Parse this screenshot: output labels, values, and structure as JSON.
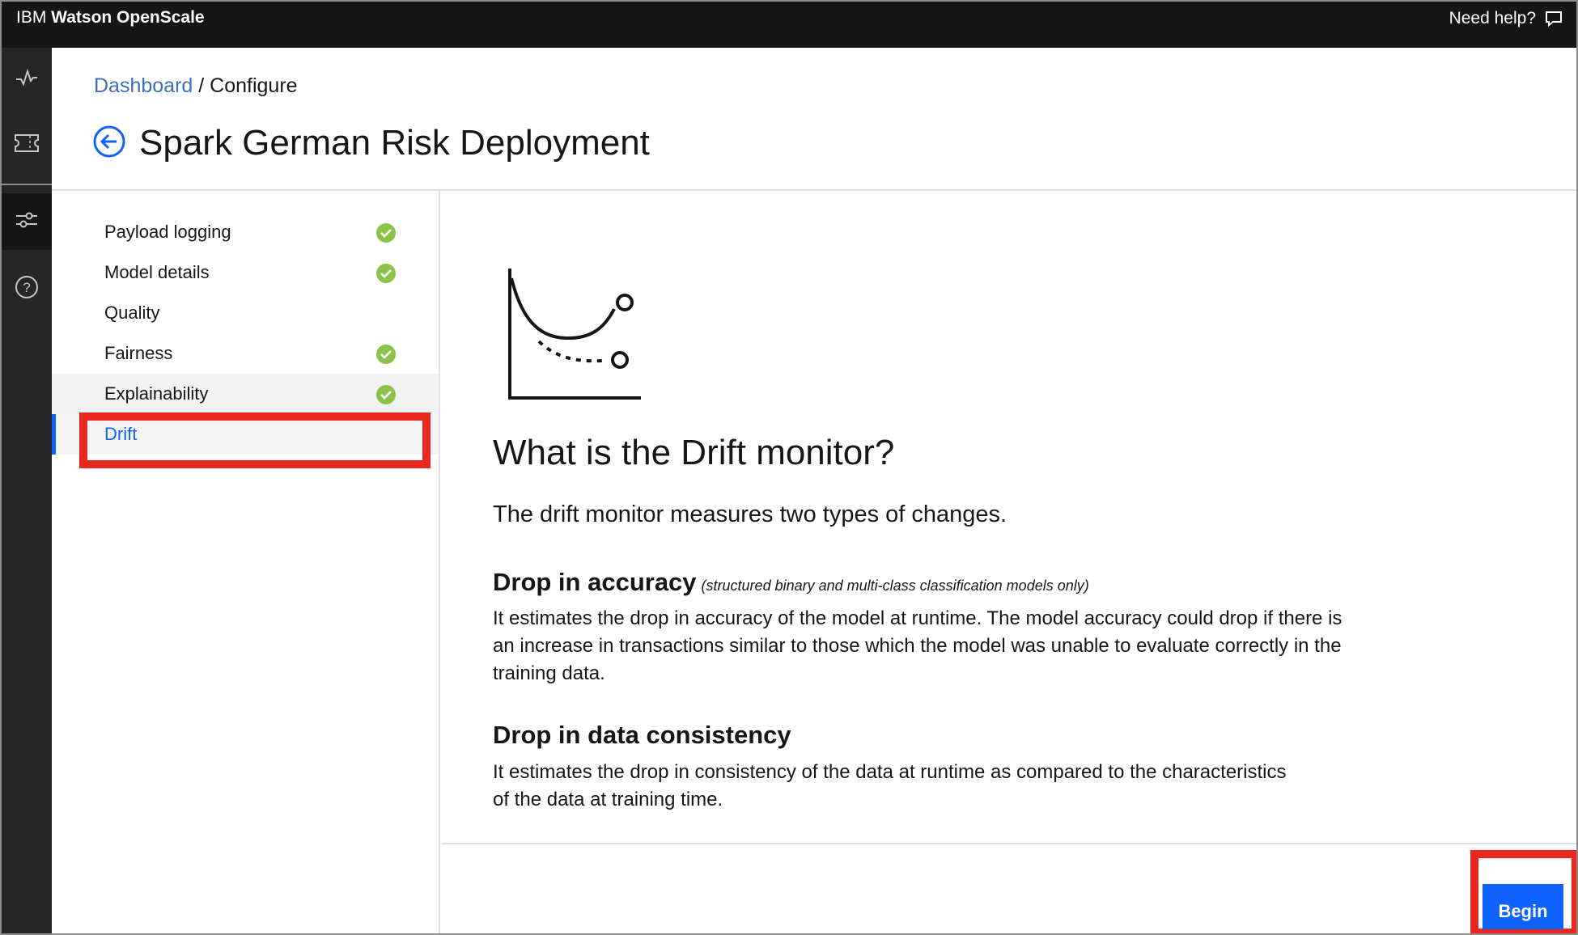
{
  "app": {
    "brand_prefix": "IBM ",
    "brand_name": "Watson OpenScale",
    "help_label": "Need help?"
  },
  "rail": {
    "icons": [
      "activity-icon",
      "ticket-icon",
      "sliders-icon",
      "help-circle-icon"
    ]
  },
  "breadcrumb": {
    "link": "Dashboard",
    "separator": " / ",
    "current": "Configure"
  },
  "page": {
    "title": "Spark German Risk Deployment"
  },
  "nav": {
    "items": [
      {
        "label": "Payload logging",
        "complete": true
      },
      {
        "label": "Model details",
        "complete": true
      },
      {
        "label": "Quality",
        "complete": false
      },
      {
        "label": "Fairness",
        "complete": true
      },
      {
        "label": "Explainability",
        "complete": true
      },
      {
        "label": "Drift",
        "complete": false,
        "selected": true
      }
    ]
  },
  "main": {
    "heading": "What is the Drift monitor?",
    "lead": "The drift monitor measures two types of changes.",
    "section1_title": "Drop in accuracy",
    "section1_note": "(structured binary and multi-class classification models only)",
    "section1_text": "It estimates the drop in accuracy of the model at runtime. The model accuracy could drop if there is an increase in transactions similar to those which the model was unable to evaluate correctly in the training data.",
    "section2_title": "Drop in data consistency",
    "section2_text": "It estimates the drop in consistency of the data at runtime as compared to the characteristics of the data at training time."
  },
  "footer": {
    "begin_label": "Begin"
  },
  "colors": {
    "accent": "#0f62fe",
    "success": "#8bc34a",
    "annotation": "#e8281e",
    "topbar": "#161616"
  }
}
